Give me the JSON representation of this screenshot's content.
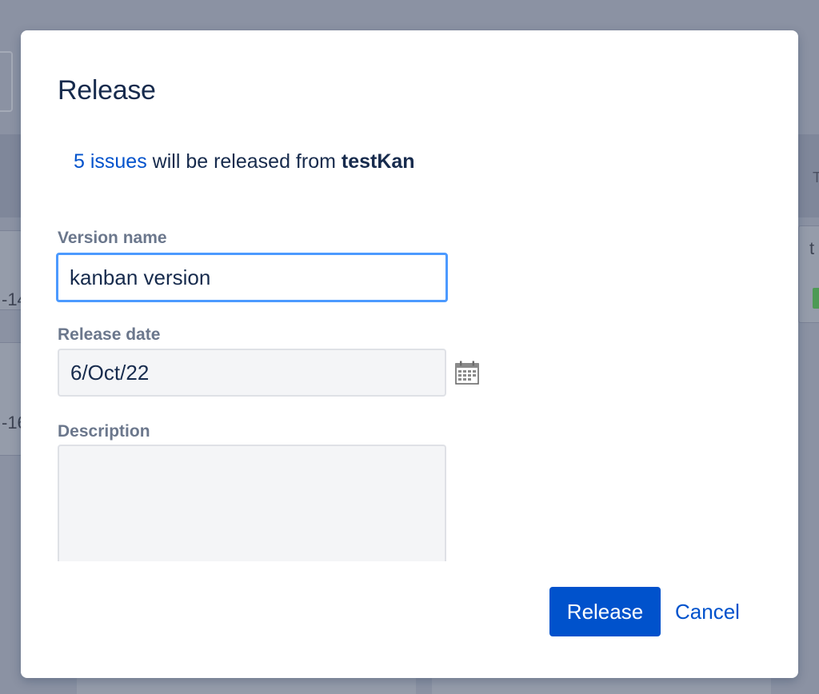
{
  "dialog": {
    "title": "Release",
    "summary": {
      "issues_link": "5 issues",
      "middle_text": " will be released from ",
      "project_name": "testKan"
    },
    "fields": {
      "version_name": {
        "label": "Version name",
        "value": "kanban version"
      },
      "release_date": {
        "label": "Release date",
        "value": "6/Oct/22",
        "picker_icon": "calendar-icon"
      },
      "description": {
        "label": "Description",
        "value": ""
      }
    },
    "buttons": {
      "release_label": "Release",
      "cancel_label": "Cancel"
    }
  },
  "background": {
    "partial_texts": [
      "-14",
      "-16",
      "t",
      "T"
    ]
  },
  "colors": {
    "primary": "#0052cc",
    "title_text": "#172b4d",
    "label_text": "#6b778c",
    "focus_border": "#4c9aff",
    "field_bg": "#f4f5f7",
    "overlay": "#8b92a3"
  }
}
